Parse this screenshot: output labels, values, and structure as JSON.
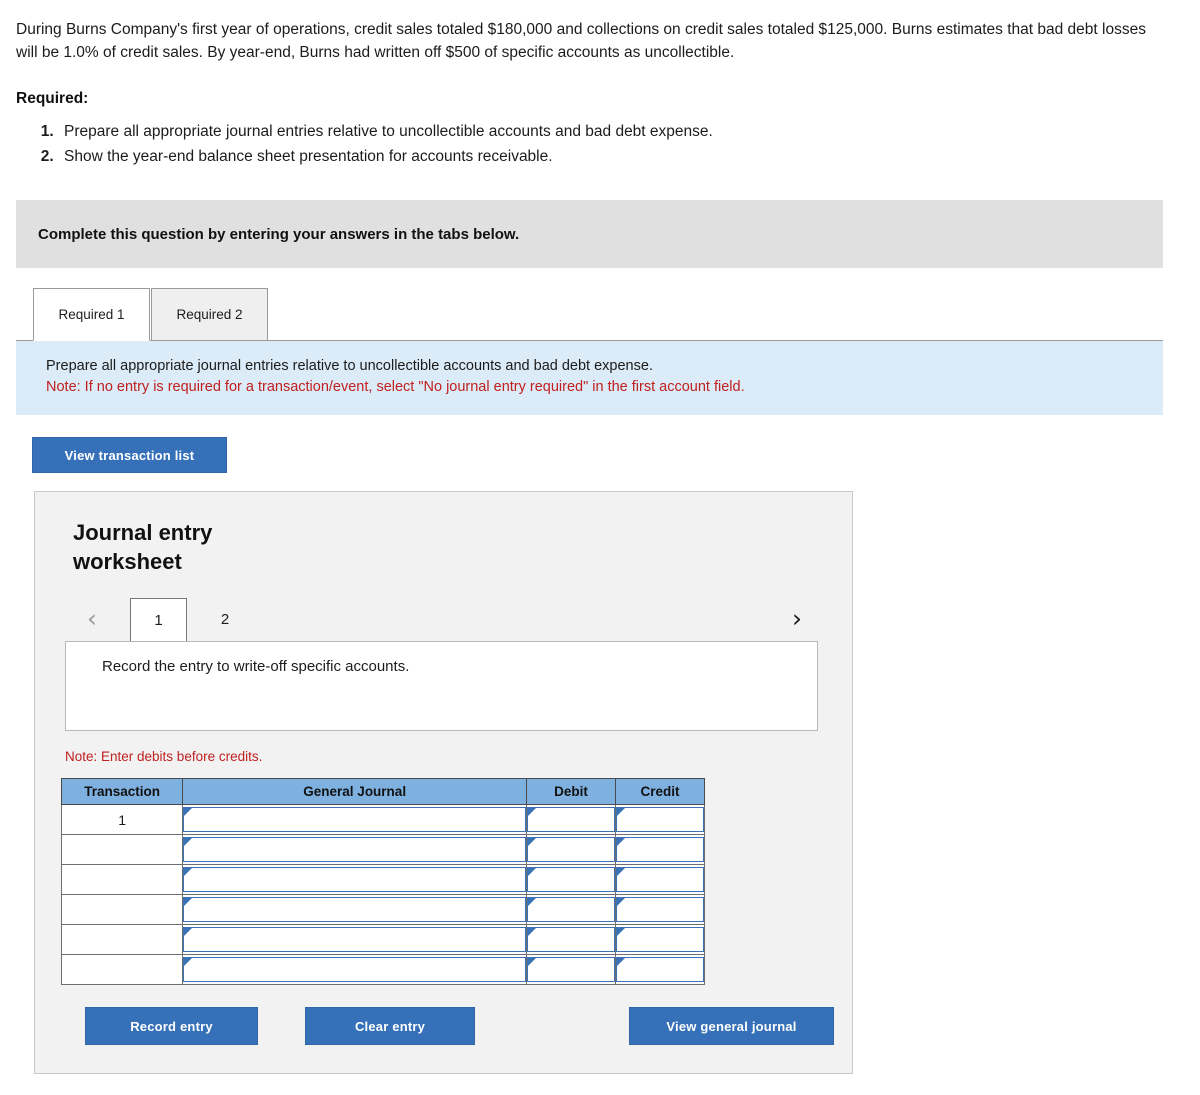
{
  "problem": {
    "statement": "During Burns Company's first year of operations, credit sales totaled $180,000 and collections on credit sales totaled $125,000. Burns estimates that bad debt losses will be 1.0% of credit sales. By year-end, Burns had written off $500 of specific accounts as uncollectible.",
    "required_heading": "Required:",
    "required_items": [
      "Prepare all appropriate journal entries relative to uncollectible accounts and bad debt expense.",
      "Show the year-end balance sheet presentation for accounts receivable."
    ]
  },
  "callout": {
    "text": "Complete this question by entering your answers in the tabs below."
  },
  "requirement_tabs": [
    {
      "label": "Required 1",
      "active": true
    },
    {
      "label": "Required 2",
      "active": false
    }
  ],
  "instruction": {
    "main": "Prepare all appropriate journal entries relative to uncollectible accounts and bad debt expense.",
    "note": "Note: If no entry is required for a transaction/event, select \"No journal entry required\" in the first account field."
  },
  "toolbar": {
    "view_transaction_list_label": "View transaction list"
  },
  "worksheet": {
    "title": "Journal entry worksheet",
    "pager": {
      "prev_icon": "‹",
      "next_icon": "›",
      "pages": [
        {
          "label": "1",
          "active": true
        },
        {
          "label": "2",
          "active": false
        }
      ]
    },
    "entry_description": "Record the entry to write-off specific accounts.",
    "note_debits": "Note: Enter debits before credits.",
    "table": {
      "columns": [
        "Transaction",
        "General Journal",
        "Debit",
        "Credit"
      ],
      "rows": [
        {
          "transaction": "1",
          "general_journal": "",
          "debit": "",
          "credit": ""
        },
        {
          "transaction": "",
          "general_journal": "",
          "debit": "",
          "credit": ""
        },
        {
          "transaction": "",
          "general_journal": "",
          "debit": "",
          "credit": ""
        },
        {
          "transaction": "",
          "general_journal": "",
          "debit": "",
          "credit": ""
        },
        {
          "transaction": "",
          "general_journal": "",
          "debit": "",
          "credit": ""
        },
        {
          "transaction": "",
          "general_journal": "",
          "debit": "",
          "credit": ""
        }
      ]
    },
    "actions": {
      "record_entry_label": "Record entry",
      "clear_entry_label": "Clear entry",
      "view_general_journal_label": "View general journal"
    }
  },
  "colors": {
    "button_blue": "#3570b8",
    "table_header_blue": "#7eb0e0",
    "instruction_band_blue": "#dbebf7",
    "callout_gray": "#e0e0e0",
    "note_red": "#c02020",
    "panel_gray": "#f2f2f2",
    "input_border_blue": "#3a72b5"
  }
}
